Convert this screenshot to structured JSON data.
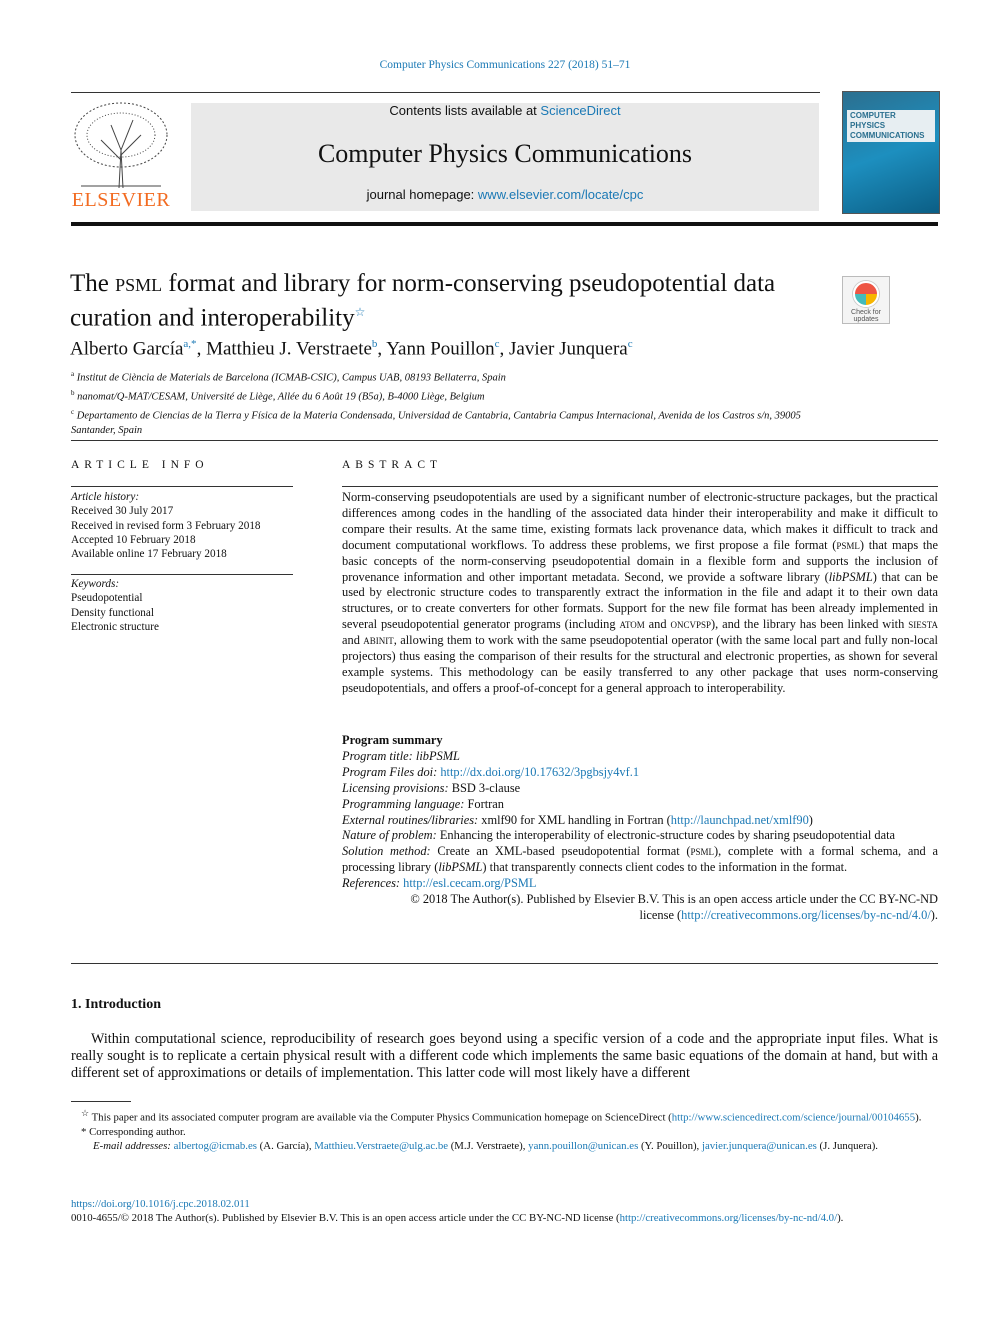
{
  "citation": "Computer Physics Communications 227 (2018) 51–71",
  "banner": {
    "contents_prefix": "Contents lists available at ",
    "contents_link": "ScienceDirect",
    "journal_title": "Computer Physics Communications",
    "homepage_prefix": "journal homepage: ",
    "homepage_link": "www.elsevier.com/locate/cpc"
  },
  "publisher_logo": "ELSEVIER",
  "cover_title": "COMPUTER PHYSICS COMMUNICATIONS",
  "check_updates": "Check for updates",
  "title": {
    "pre": "The ",
    "sc": "psml",
    "post": " format and library for norm-conserving pseudopotential data curation and interoperability",
    "mark": "☆"
  },
  "authors": [
    {
      "name": "Alberto García",
      "sup": "a,*"
    },
    {
      "name": "Matthieu J. Verstraete",
      "sup": "b"
    },
    {
      "name": "Yann Pouillon",
      "sup": "c"
    },
    {
      "name": "Javier Junquera",
      "sup": "c"
    }
  ],
  "affiliations": [
    {
      "sup": "a",
      "text": "Institut de Ciència de Materials de Barcelona (ICMAB-CSIC), Campus UAB, 08193 Bellaterra, Spain"
    },
    {
      "sup": "b",
      "text": "nanomat/Q-MAT/CESAM, Université de Liège, Allée du 6 Août 19 (B5a), B-4000 Liège, Belgium"
    },
    {
      "sup": "c",
      "text": "Departamento de Ciencias de la Tierra y Física de la Materia Condensada, Universidad de Cantabria, Cantabria Campus Internacional, Avenida de los Castros s/n, 39005 Santander, Spain"
    }
  ],
  "article_info": {
    "heading": "ARTICLE INFO",
    "history_label": "Article history:",
    "history": [
      "Received 30 July 2017",
      "Received in revised form 3 February 2018",
      "Accepted 10 February 2018",
      "Available online 17 February 2018"
    ],
    "keywords_label": "Keywords:",
    "keywords": [
      "Pseudopotential",
      "Density functional",
      "Electronic structure"
    ]
  },
  "abstract": {
    "heading": "ABSTRACT",
    "segments": [
      {
        "t": "Norm-conserving pseudopotentials are used by a significant number of electronic-structure packages, but the practical differences among codes in the handling of the associated data hinder their interoperability and make it difficult to compare their results. At the same time, existing formats lack provenance data, which makes it difficult to track and document computational workflows. To address these problems, we first propose a file format ("
      },
      {
        "t": "psml",
        "sc": true
      },
      {
        "t": ") that maps the basic concepts of the norm-conserving pseudopotential domain in a flexible form and supports the inclusion of provenance information and other important metadata. Second, we provide a software library ("
      },
      {
        "t": "libPSML",
        "i": true
      },
      {
        "t": ") that can be used by electronic structure codes to transparently extract the information in the file and adapt it to their own data structures, or to create converters for other formats. Support for the new file format has been already implemented in several pseudopotential generator programs (including "
      },
      {
        "t": "atom",
        "sc": true
      },
      {
        "t": " and "
      },
      {
        "t": "oncvpsp",
        "sc": true
      },
      {
        "t": "), and the library has been linked with "
      },
      {
        "t": "siesta",
        "sc": true
      },
      {
        "t": " and "
      },
      {
        "t": "abinit",
        "sc": true
      },
      {
        "t": ", allowing them to work with the same pseudopotential operator (with the same local part and fully non-local projectors) thus easing the comparison of their results for the structural and electronic properties, as shown for several example systems. This methodology can be easily transferred to any other package that uses norm-conserving pseudopotentials, and offers a proof-of-concept for a general approach to interoperability."
      }
    ]
  },
  "program_summary": {
    "heading": "Program summary",
    "title_label": "Program title:",
    "title_value": " libPSML",
    "doi_label": "Program Files doi:",
    "doi_link": "http://dx.doi.org/10.17632/3pgbsjy4vf.1",
    "licensing_label": "Licensing provisions:",
    "licensing_value": " BSD 3-clause",
    "language_label": "Programming language:",
    "language_value": " Fortran",
    "external_label": "External routines/libraries:",
    "external_value": " xmlf90 for XML handling in Fortran (",
    "external_link": "http://launchpad.net/xmlf90",
    "external_close": ")",
    "nature_label": "Nature of problem:",
    "nature_value": " Enhancing the interoperability of electronic-structure codes by sharing pseudopotential data",
    "solution_label": "Solution method:",
    "solution_1": " Create an XML-based pseudopotential format (",
    "solution_sc": "psml",
    "solution_2": "), complete with a formal schema, and a processing library (",
    "solution_i": "libPSML",
    "solution_3": ") that transparently connects client codes to the information in the format.",
    "references_label": "References:",
    "references_link": "http://esl.cecam.org/PSML",
    "copyright_1": "© 2018 The Author(s). Published by Elsevier B.V. This is an open access article under the CC BY-NC-ND",
    "copyright_2": "license (",
    "copyright_link": "http://creativecommons.org/licenses/by-nc-nd/4.0/",
    "copyright_close": ")."
  },
  "introduction": {
    "heading": "1.  Introduction",
    "text": "Within computational science, reproducibility of research goes beyond using a specific version of a code and the appropriate input files. What is really sought is to replicate a certain physical result with a different code which implements the same basic equations of the domain at hand, but with a different set of approximations or details of implementation. This latter code will most likely have a different"
  },
  "footnotes": {
    "star_mark": "☆",
    "star_text": " This paper and its associated computer program are available via the Computer Physics Communication homepage on ScienceDirect (",
    "star_link": "http://www.sciencedirect.com/science/journal/00104655",
    "star_close": ").",
    "corr_mark": "*",
    "corr_text": " Corresponding author.",
    "email_label": "E-mail addresses:",
    "emails": [
      {
        "email": "albertog@icmab.es",
        "who": " (A. García), "
      },
      {
        "email": "Matthieu.Verstraete@ulg.ac.be",
        "who": " (M.J. Verstraete), "
      },
      {
        "email": "yann.pouillon@unican.es",
        "who": " (Y. Pouillon), "
      },
      {
        "email": "javier.junquera@unican.es",
        "who": " (J. Junquera)."
      }
    ]
  },
  "bottom": {
    "doi": "https://doi.org/10.1016/j.cpc.2018.02.011",
    "license_text": "0010-4655/© 2018 The Author(s). Published by Elsevier B.V. This is an open access article under the CC BY-NC-ND license (",
    "license_link": "http://creativecommons.org/licenses/by-nc-nd/4.0/",
    "license_close": ")."
  },
  "colors": {
    "link": "#1b79b5",
    "elsevier_orange": "#f26b21",
    "banner_bg": "#e9e9e9"
  }
}
